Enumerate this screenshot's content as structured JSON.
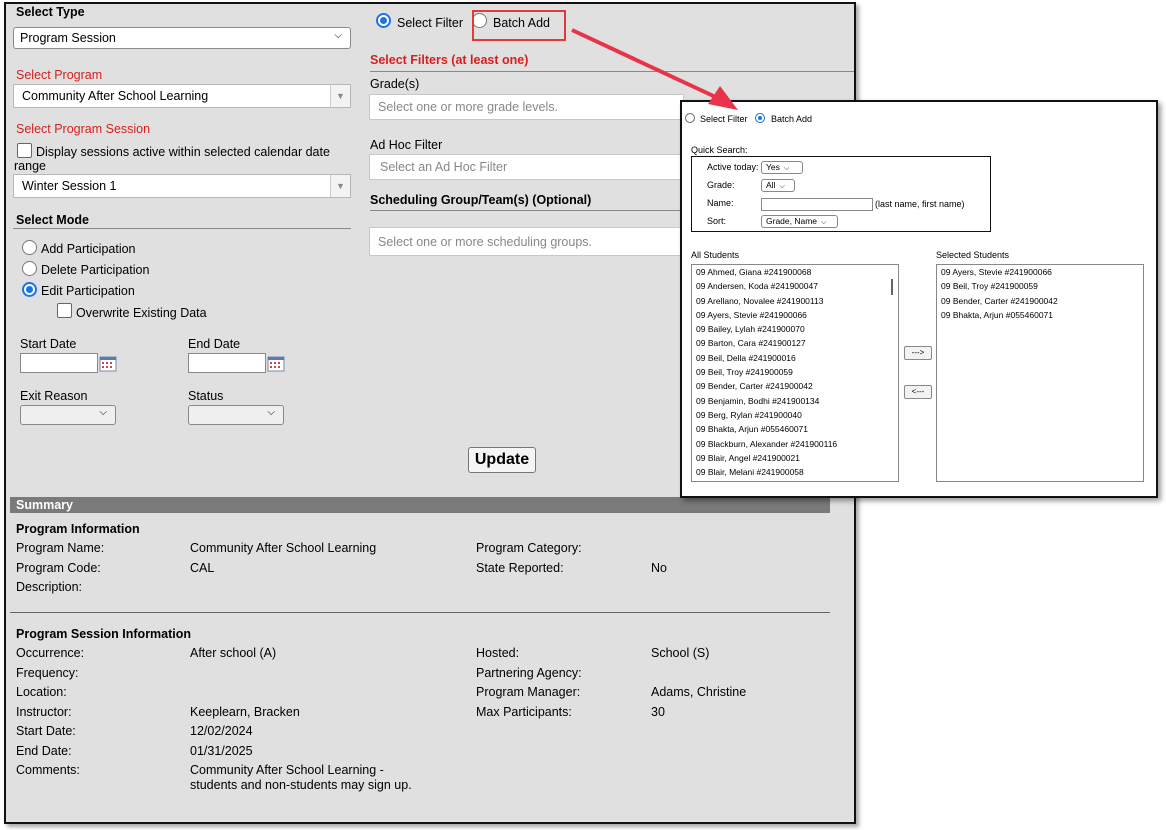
{
  "select_type": {
    "label": "Select Type",
    "value": "Program Session"
  },
  "select_program": {
    "label": "Select Program",
    "value": "Community After School Learning"
  },
  "select_program_session": {
    "label": "Select Program Session",
    "checkbox_label_line1": "Display sessions active within selected calendar date",
    "checkbox_label_line2": "range",
    "value": "Winter Session 1"
  },
  "select_mode": {
    "label": "Select Mode",
    "options": [
      "Add Participation",
      "Delete Participation",
      "Edit Participation"
    ],
    "selected": "Edit Participation",
    "overwrite_label": "Overwrite Existing Data"
  },
  "dates": {
    "start_label": "Start Date",
    "end_label": "End Date",
    "exit_reason_label": "Exit Reason",
    "status_label": "Status"
  },
  "mode_radios": {
    "select_filter": "Select Filter",
    "batch_add": "Batch Add"
  },
  "filters": {
    "heading": "Select Filters (at least one)",
    "grades_label": "Grade(s)",
    "grades_placeholder": "Select one or more grade levels.",
    "adhoc_label": "Ad Hoc Filter",
    "adhoc_placeholder": "Select an Ad Hoc Filter",
    "sched_label": "Scheduling Group/Team(s) (Optional)",
    "sched_placeholder": "Select one or more scheduling groups."
  },
  "update_label": "Update",
  "summary": {
    "bar": "Summary",
    "program_info_title": "Program Information",
    "program_name_label": "Program Name:",
    "program_name": "Community After School Learning",
    "program_code_label": "Program Code:",
    "program_code": "CAL",
    "description_label": "Description:",
    "program_category_label": "Program Category:",
    "state_reported_label": "State Reported:",
    "state_reported": "No",
    "session_info_title": "Program Session Information",
    "occurrence_label": "Occurrence:",
    "occurrence": "After school (A)",
    "frequency_label": "Frequency:",
    "location_label": "Location:",
    "instructor_label": "Instructor:",
    "instructor": "Keeplearn, Bracken",
    "start_date_label": "Start Date:",
    "start_date": "12/02/2024",
    "end_date_label": "End Date:",
    "end_date": "01/31/2025",
    "comments_label": "Comments:",
    "comments_line1": "Community After School Learning -",
    "comments_line2": "students and non-students may sign up.",
    "hosted_label": "Hosted:",
    "hosted": "School (S)",
    "partnering_label": "Partnering Agency:",
    "manager_label": "Program Manager:",
    "manager": "Adams, Christine",
    "max_label": "Max Participants:",
    "max": "30"
  },
  "popup": {
    "select_filter": "Select Filter",
    "batch_add": "Batch Add",
    "quick_search": "Quick Search:",
    "active_today_label": "Active today:",
    "active_today": "Yes",
    "grade_label": "Grade:",
    "grade": "All",
    "name_label": "Name:",
    "name_hint": "(last name, first name)",
    "sort_label": "Sort:",
    "sort": "Grade, Name",
    "all_students_label": "All Students",
    "selected_students_label": "Selected Students",
    "add_arrow": "--->",
    "remove_arrow": "<---",
    "all_students": [
      "09 Ahmed, Giana  #241900068",
      "09 Andersen, Koda  #241900047",
      "09 Arellano, Novalee  #241900113",
      "09 Ayers, Stevie  #241900066",
      "09 Bailey, Lylah  #241900070",
      "09 Barton, Cara  #241900127",
      "09 Beil, Della  #241900016",
      "09 Beil, Troy  #241900059",
      "09 Bender, Carter  #241900042",
      "09 Benjamin, Bodhi  #241900134",
      "09 Berg, Rylan  #241900040",
      "09 Bhakta, Arjun  #055460071",
      "09 Blackburn, Alexander  #241900116",
      "09 Blair, Angel  #241900021",
      "09 Blair, Melani  #241900058"
    ],
    "selected_students": [
      "09 Ayers, Stevie  #241900066",
      "09 Beil, Troy  #241900059",
      "09 Bender, Carter  #241900042",
      "09 Bhakta, Arjun  #055460071"
    ]
  },
  "colors": {
    "accent_red": "#d81f1f",
    "radio_blue": "#1a73e8",
    "panel_gray": "#e0e0e0",
    "summary_bar": "#7a7a7a",
    "arrow_red": "#e8344a"
  },
  "icons": [
    "chevron-down-icon",
    "calendar-icon",
    "arrow-icon"
  ]
}
